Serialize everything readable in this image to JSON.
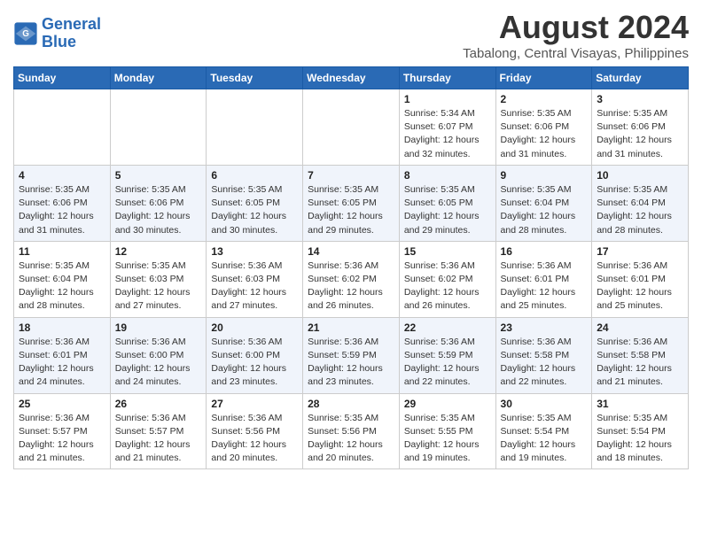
{
  "header": {
    "logo_line1": "General",
    "logo_line2": "Blue",
    "month_year": "August 2024",
    "location": "Tabalong, Central Visayas, Philippines"
  },
  "days_of_week": [
    "Sunday",
    "Monday",
    "Tuesday",
    "Wednesday",
    "Thursday",
    "Friday",
    "Saturday"
  ],
  "weeks": [
    [
      {
        "day": "",
        "info": ""
      },
      {
        "day": "",
        "info": ""
      },
      {
        "day": "",
        "info": ""
      },
      {
        "day": "",
        "info": ""
      },
      {
        "day": "1",
        "info": "Sunrise: 5:34 AM\nSunset: 6:07 PM\nDaylight: 12 hours\nand 32 minutes."
      },
      {
        "day": "2",
        "info": "Sunrise: 5:35 AM\nSunset: 6:06 PM\nDaylight: 12 hours\nand 31 minutes."
      },
      {
        "day": "3",
        "info": "Sunrise: 5:35 AM\nSunset: 6:06 PM\nDaylight: 12 hours\nand 31 minutes."
      }
    ],
    [
      {
        "day": "4",
        "info": "Sunrise: 5:35 AM\nSunset: 6:06 PM\nDaylight: 12 hours\nand 31 minutes."
      },
      {
        "day": "5",
        "info": "Sunrise: 5:35 AM\nSunset: 6:06 PM\nDaylight: 12 hours\nand 30 minutes."
      },
      {
        "day": "6",
        "info": "Sunrise: 5:35 AM\nSunset: 6:05 PM\nDaylight: 12 hours\nand 30 minutes."
      },
      {
        "day": "7",
        "info": "Sunrise: 5:35 AM\nSunset: 6:05 PM\nDaylight: 12 hours\nand 29 minutes."
      },
      {
        "day": "8",
        "info": "Sunrise: 5:35 AM\nSunset: 6:05 PM\nDaylight: 12 hours\nand 29 minutes."
      },
      {
        "day": "9",
        "info": "Sunrise: 5:35 AM\nSunset: 6:04 PM\nDaylight: 12 hours\nand 28 minutes."
      },
      {
        "day": "10",
        "info": "Sunrise: 5:35 AM\nSunset: 6:04 PM\nDaylight: 12 hours\nand 28 minutes."
      }
    ],
    [
      {
        "day": "11",
        "info": "Sunrise: 5:35 AM\nSunset: 6:04 PM\nDaylight: 12 hours\nand 28 minutes."
      },
      {
        "day": "12",
        "info": "Sunrise: 5:35 AM\nSunset: 6:03 PM\nDaylight: 12 hours\nand 27 minutes."
      },
      {
        "day": "13",
        "info": "Sunrise: 5:36 AM\nSunset: 6:03 PM\nDaylight: 12 hours\nand 27 minutes."
      },
      {
        "day": "14",
        "info": "Sunrise: 5:36 AM\nSunset: 6:02 PM\nDaylight: 12 hours\nand 26 minutes."
      },
      {
        "day": "15",
        "info": "Sunrise: 5:36 AM\nSunset: 6:02 PM\nDaylight: 12 hours\nand 26 minutes."
      },
      {
        "day": "16",
        "info": "Sunrise: 5:36 AM\nSunset: 6:01 PM\nDaylight: 12 hours\nand 25 minutes."
      },
      {
        "day": "17",
        "info": "Sunrise: 5:36 AM\nSunset: 6:01 PM\nDaylight: 12 hours\nand 25 minutes."
      }
    ],
    [
      {
        "day": "18",
        "info": "Sunrise: 5:36 AM\nSunset: 6:01 PM\nDaylight: 12 hours\nand 24 minutes."
      },
      {
        "day": "19",
        "info": "Sunrise: 5:36 AM\nSunset: 6:00 PM\nDaylight: 12 hours\nand 24 minutes."
      },
      {
        "day": "20",
        "info": "Sunrise: 5:36 AM\nSunset: 6:00 PM\nDaylight: 12 hours\nand 23 minutes."
      },
      {
        "day": "21",
        "info": "Sunrise: 5:36 AM\nSunset: 5:59 PM\nDaylight: 12 hours\nand 23 minutes."
      },
      {
        "day": "22",
        "info": "Sunrise: 5:36 AM\nSunset: 5:59 PM\nDaylight: 12 hours\nand 22 minutes."
      },
      {
        "day": "23",
        "info": "Sunrise: 5:36 AM\nSunset: 5:58 PM\nDaylight: 12 hours\nand 22 minutes."
      },
      {
        "day": "24",
        "info": "Sunrise: 5:36 AM\nSunset: 5:58 PM\nDaylight: 12 hours\nand 21 minutes."
      }
    ],
    [
      {
        "day": "25",
        "info": "Sunrise: 5:36 AM\nSunset: 5:57 PM\nDaylight: 12 hours\nand 21 minutes."
      },
      {
        "day": "26",
        "info": "Sunrise: 5:36 AM\nSunset: 5:57 PM\nDaylight: 12 hours\nand 21 minutes."
      },
      {
        "day": "27",
        "info": "Sunrise: 5:36 AM\nSunset: 5:56 PM\nDaylight: 12 hours\nand 20 minutes."
      },
      {
        "day": "28",
        "info": "Sunrise: 5:35 AM\nSunset: 5:56 PM\nDaylight: 12 hours\nand 20 minutes."
      },
      {
        "day": "29",
        "info": "Sunrise: 5:35 AM\nSunset: 5:55 PM\nDaylight: 12 hours\nand 19 minutes."
      },
      {
        "day": "30",
        "info": "Sunrise: 5:35 AM\nSunset: 5:54 PM\nDaylight: 12 hours\nand 19 minutes."
      },
      {
        "day": "31",
        "info": "Sunrise: 5:35 AM\nSunset: 5:54 PM\nDaylight: 12 hours\nand 18 minutes."
      }
    ]
  ]
}
